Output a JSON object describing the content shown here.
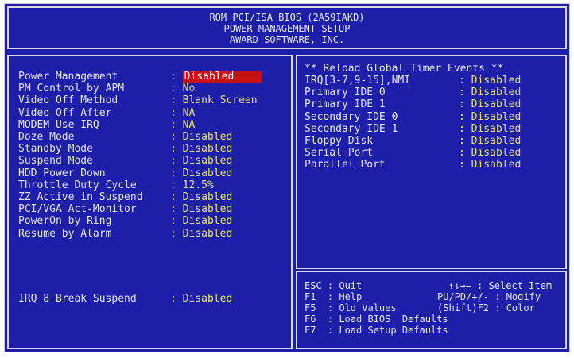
{
  "header": {
    "line1": "ROM PCI/ISA BIOS (2A59IAKD)",
    "line2": "POWER MANAGEMENT SETUP",
    "line3": "AWARD SOFTWARE, INC."
  },
  "left_settings": [
    {
      "label": "Power Management",
      "value": "Disabled"
    },
    {
      "label": "PM Control by APM",
      "value": "No"
    },
    {
      "label": "Video Off Method",
      "value": "Blank Screen"
    },
    {
      "label": "Video Off After",
      "value": "NA"
    },
    {
      "label": "MODEM Use IRQ",
      "value": "NA"
    },
    {
      "label": "Doze Mode",
      "value": "Disabled"
    },
    {
      "label": "Standby Mode",
      "value": "Disabled"
    },
    {
      "label": "Suspend Mode",
      "value": "Disabled"
    },
    {
      "label": "HDD Power Down",
      "value": "Disabled"
    },
    {
      "label": "Throttle Duty Cycle",
      "value": "12.5%"
    },
    {
      "label": "ZZ Active in Suspend",
      "value": "Disabled"
    },
    {
      "label": "PCI/VGA Act-Monitor",
      "value": "Disabled"
    },
    {
      "label": "PowerOn by Ring",
      "value": "Disabled"
    },
    {
      "label": "Resume by Alarm",
      "value": "Disabled"
    }
  ],
  "irq8": {
    "label": "IRQ 8 Break Suspend",
    "value": "Disabled"
  },
  "right_title": "** Reload Global Timer Events **",
  "right_settings": [
    {
      "label": "IRQ[3-7,9-15],NMI",
      "value": "Disabled"
    },
    {
      "label": "Primary IDE 0",
      "value": "Disabled"
    },
    {
      "label": "Primary IDE 1",
      "value": "Disabled"
    },
    {
      "label": "Secondary IDE 0",
      "value": "Disabled"
    },
    {
      "label": "Secondary IDE 1",
      "value": "Disabled"
    },
    {
      "label": "Floppy Disk",
      "value": "Disabled"
    },
    {
      "label": "Serial Port",
      "value": "Disabled"
    },
    {
      "label": "Parallel Port",
      "value": "Disabled"
    }
  ],
  "keys": {
    "esc": "ESC : Quit",
    "f1": "F1  : Help",
    "f5": "F5  : Old Values",
    "f6": "F6  : Load BIOS  Defaults",
    "f7": "F7  : Load Setup Defaults",
    "select": "↑↓→← : Select Item",
    "modify": "PU/PD/+/- : Modify",
    "color": "(Shift)F2 : Color"
  },
  "colors": {
    "background": "#1d1fa8",
    "value": "#e6e07a",
    "highlight": "#c81010",
    "text": "#e4e4ee"
  }
}
